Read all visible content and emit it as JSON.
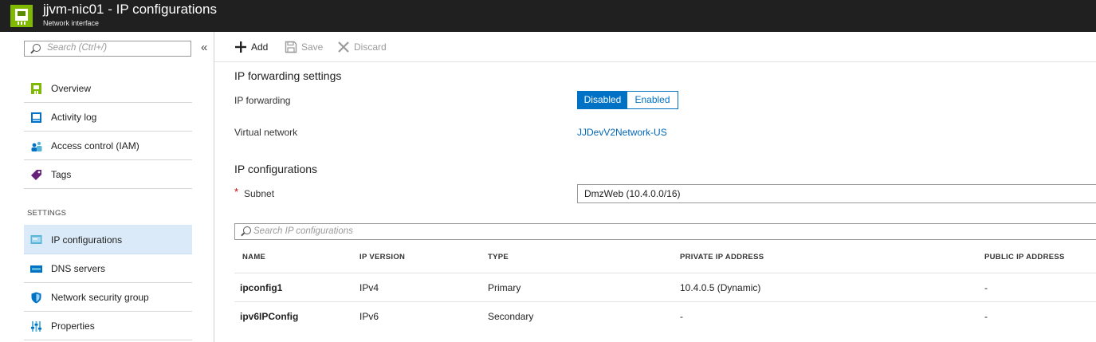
{
  "header": {
    "title": "jjvm-nic01 - IP configurations",
    "subtitle": "Network interface",
    "icon": "network-interface-icon"
  },
  "sidebar": {
    "search_placeholder": "Search (Ctrl+/)",
    "collapse_glyph": "«",
    "section_label": "SETTINGS",
    "items": [
      {
        "label": "Overview",
        "icon": "overview-icon"
      },
      {
        "label": "Activity log",
        "icon": "activity-log-icon"
      },
      {
        "label": "Access control (IAM)",
        "icon": "iam-icon"
      },
      {
        "label": "Tags",
        "icon": "tag-icon"
      },
      {
        "label": "IP configurations",
        "icon": "ip-config-icon",
        "active": true
      },
      {
        "label": "DNS servers",
        "icon": "dns-icon"
      },
      {
        "label": "Network security group",
        "icon": "shield-icon"
      },
      {
        "label": "Properties",
        "icon": "properties-icon"
      }
    ]
  },
  "toolbar": {
    "add_label": "Add",
    "save_label": "Save",
    "discard_label": "Discard"
  },
  "ip_forwarding": {
    "heading": "IP forwarding settings",
    "label": "IP forwarding",
    "options": [
      "Disabled",
      "Enabled"
    ],
    "selected": "Disabled",
    "vnet_label": "Virtual network",
    "vnet_value": "JJDevV2Network-US"
  },
  "ip_configurations": {
    "heading": "IP configurations",
    "subnet_label": "Subnet",
    "required_mark": "*",
    "subnet_value": "DmzWeb (10.4.0.0/16)",
    "search_placeholder": "Search IP configurations",
    "columns": [
      "NAME",
      "IP VERSION",
      "TYPE",
      "PRIVATE IP ADDRESS",
      "PUBLIC IP ADDRESS"
    ],
    "rows": [
      [
        "ipconfig1",
        "IPv4",
        "Primary",
        "10.4.0.5 (Dynamic)",
        "-"
      ],
      [
        "ipv6IPConfig",
        "IPv6",
        "Secondary",
        "-",
        "-"
      ]
    ]
  },
  "colors": {
    "header_bg": "#202020",
    "accent": "#0072c6",
    "link": "#0066b8",
    "active_nav_bg": "#dbeaf8",
    "required": "#cc0000"
  }
}
